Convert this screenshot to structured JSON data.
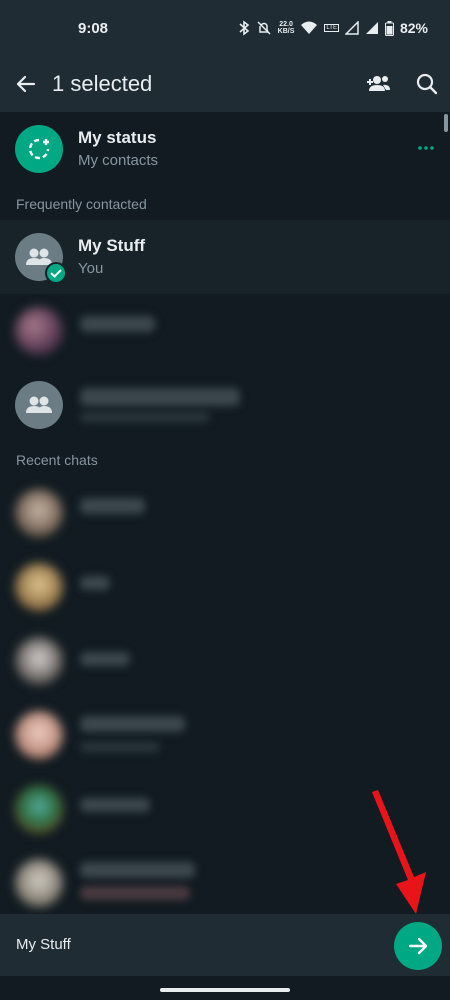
{
  "statusbar": {
    "time": "9:08",
    "net_speed_value": "22.0",
    "net_speed_unit": "KB/S",
    "lte_label": "LTE",
    "battery": "82%",
    "icons": [
      "bluetooth-icon",
      "mute-icon",
      "wifi-icon",
      "signal-icon",
      "battery-icon"
    ]
  },
  "appbar": {
    "title": "1 selected",
    "icons": [
      "back-arrow-icon",
      "add-group-icon",
      "search-icon"
    ]
  },
  "status_row": {
    "name": "My status",
    "subtitle": "My contacts",
    "more_icon": "more-horizontal-icon"
  },
  "sections": {
    "frequent": "Frequently contacted",
    "recent": "Recent chats"
  },
  "selected_contact": {
    "name": "My Stuff",
    "subtitle": "You"
  },
  "bottom": {
    "selected_names": "My Stuff",
    "send_icon": "arrow-right-icon"
  },
  "colors": {
    "background": "#111b21",
    "bar": "#1f2c34",
    "accent": "#00a884",
    "muted_text": "#8696a0",
    "annotation_arrow": "#e8141a"
  }
}
